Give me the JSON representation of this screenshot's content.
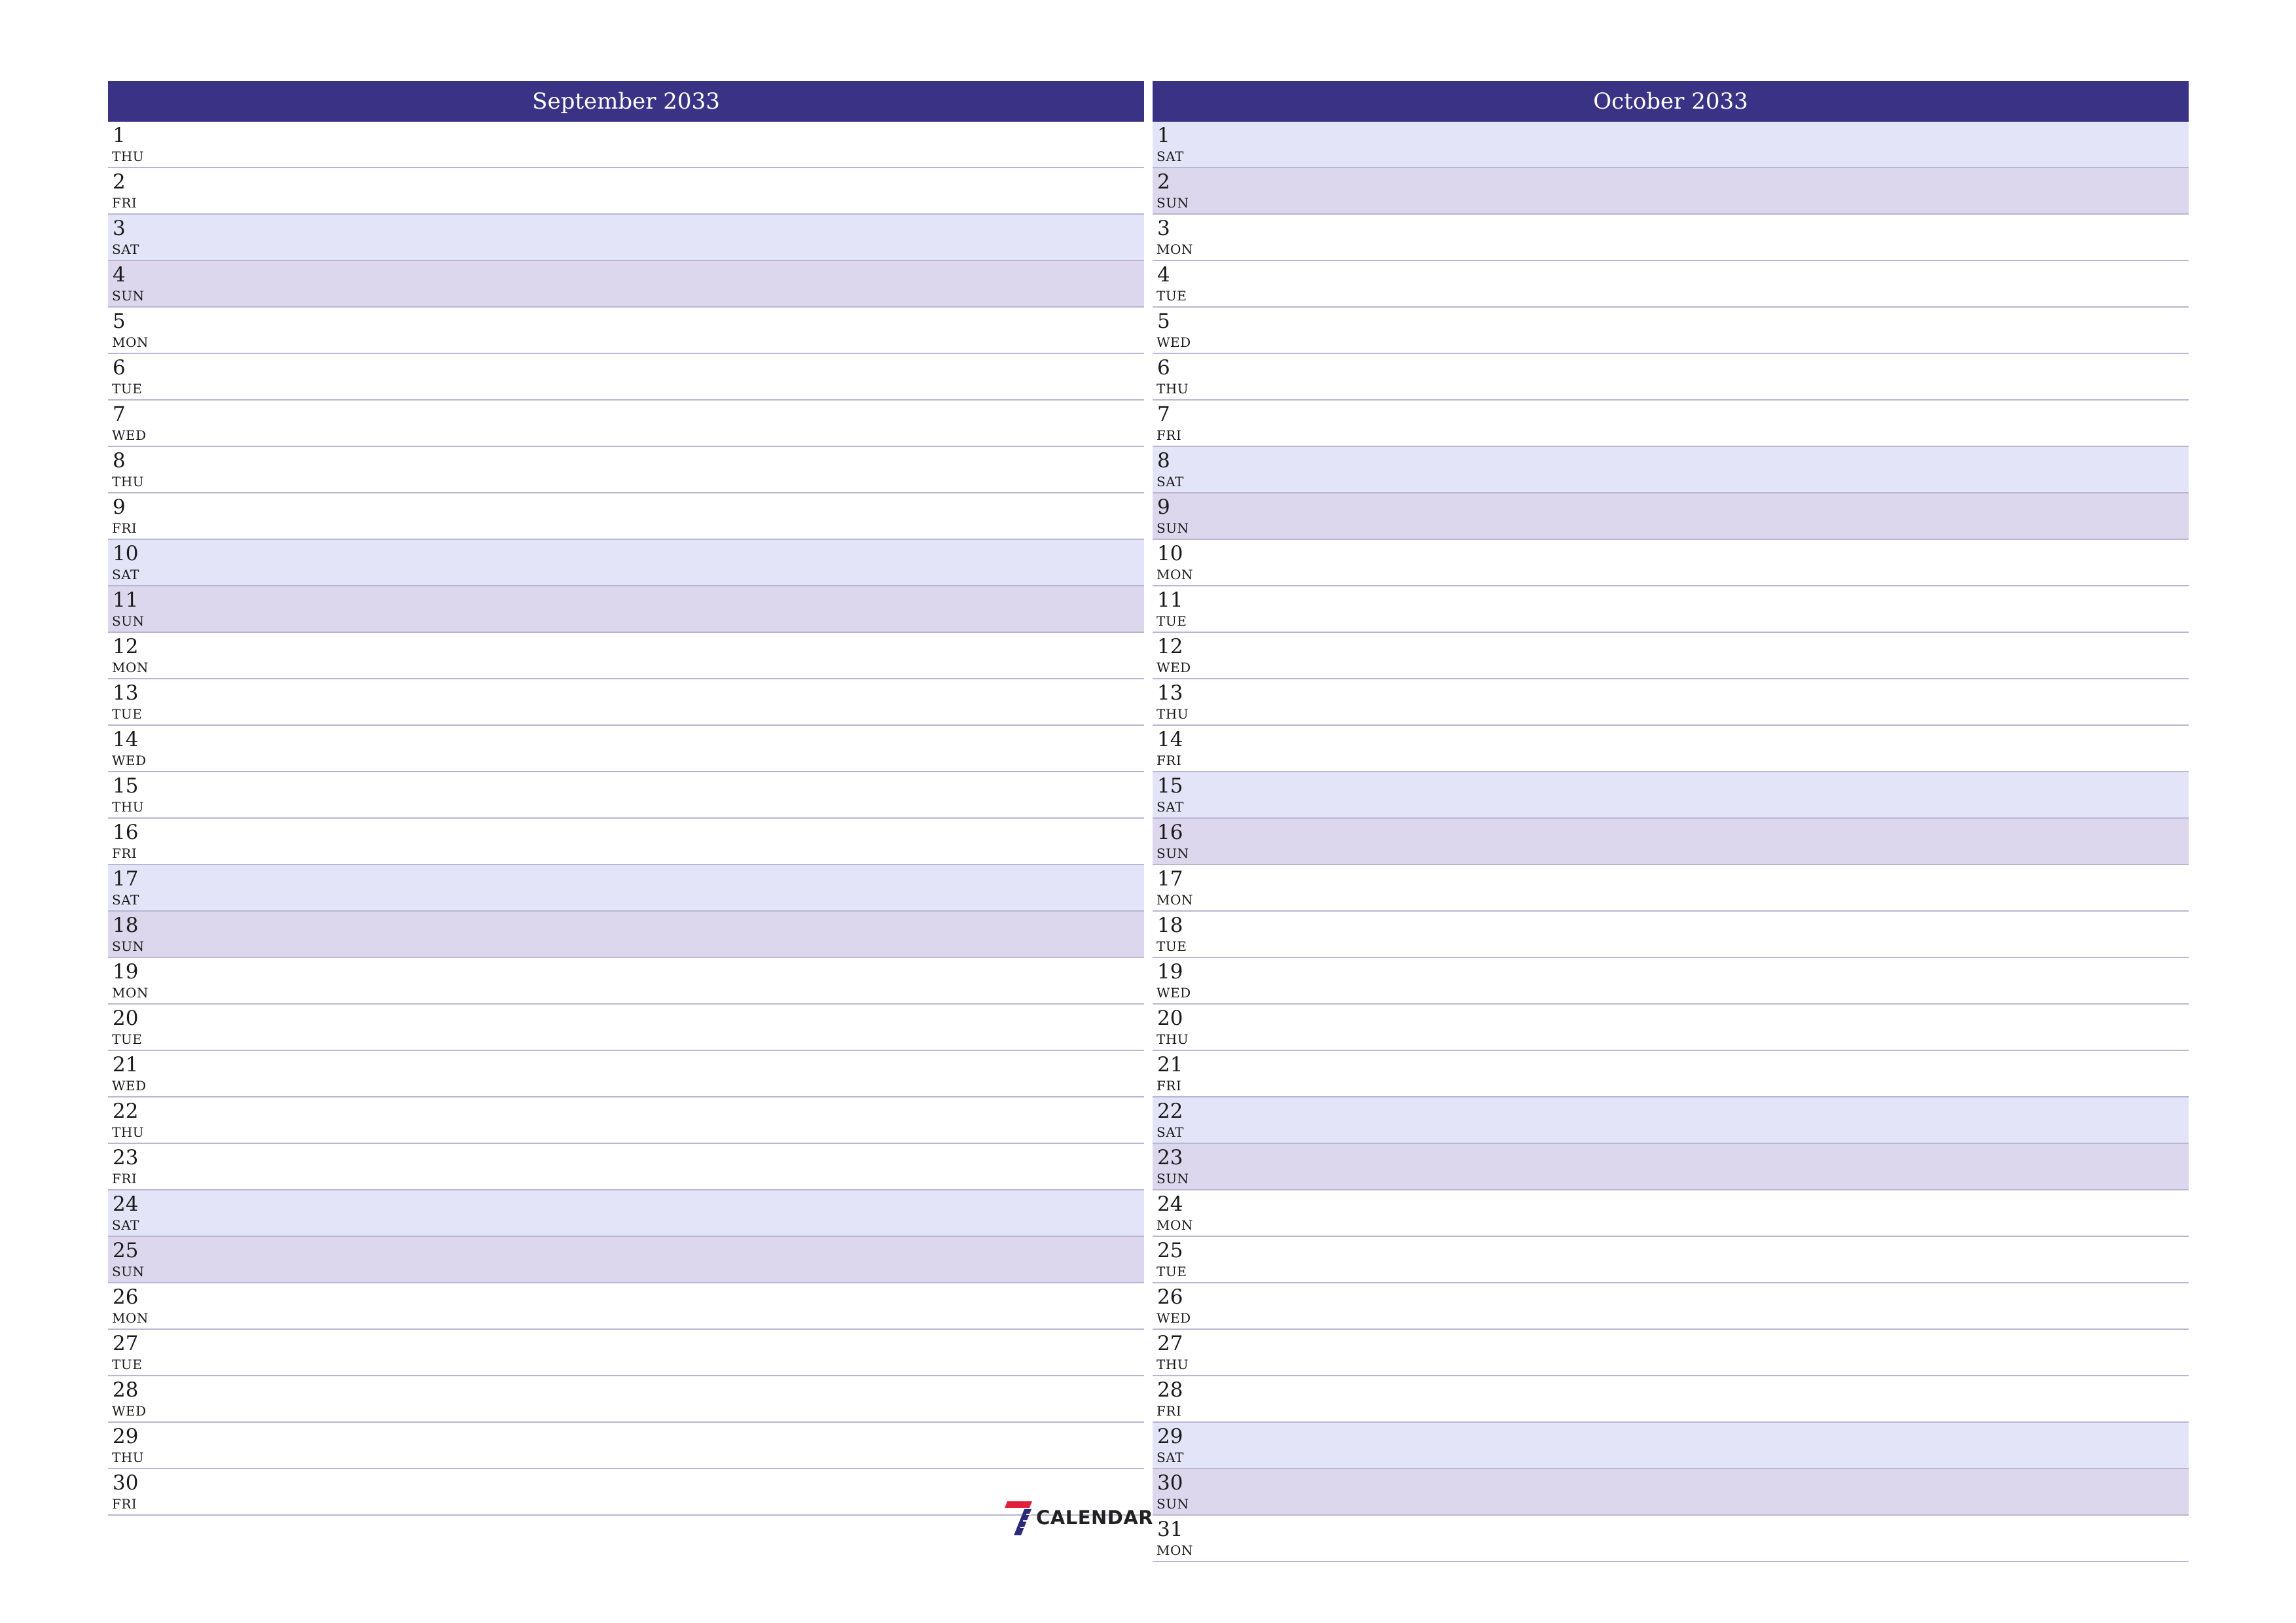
{
  "months": [
    {
      "title": "September 2033",
      "days": [
        {
          "num": "1",
          "dow": "THU"
        },
        {
          "num": "2",
          "dow": "FRI"
        },
        {
          "num": "3",
          "dow": "SAT"
        },
        {
          "num": "4",
          "dow": "SUN"
        },
        {
          "num": "5",
          "dow": "MON"
        },
        {
          "num": "6",
          "dow": "TUE"
        },
        {
          "num": "7",
          "dow": "WED"
        },
        {
          "num": "8",
          "dow": "THU"
        },
        {
          "num": "9",
          "dow": "FRI"
        },
        {
          "num": "10",
          "dow": "SAT"
        },
        {
          "num": "11",
          "dow": "SUN"
        },
        {
          "num": "12",
          "dow": "MON"
        },
        {
          "num": "13",
          "dow": "TUE"
        },
        {
          "num": "14",
          "dow": "WED"
        },
        {
          "num": "15",
          "dow": "THU"
        },
        {
          "num": "16",
          "dow": "FRI"
        },
        {
          "num": "17",
          "dow": "SAT"
        },
        {
          "num": "18",
          "dow": "SUN"
        },
        {
          "num": "19",
          "dow": "MON"
        },
        {
          "num": "20",
          "dow": "TUE"
        },
        {
          "num": "21",
          "dow": "WED"
        },
        {
          "num": "22",
          "dow": "THU"
        },
        {
          "num": "23",
          "dow": "FRI"
        },
        {
          "num": "24",
          "dow": "SAT"
        },
        {
          "num": "25",
          "dow": "SUN"
        },
        {
          "num": "26",
          "dow": "MON"
        },
        {
          "num": "27",
          "dow": "TUE"
        },
        {
          "num": "28",
          "dow": "WED"
        },
        {
          "num": "29",
          "dow": "THU"
        },
        {
          "num": "30",
          "dow": "FRI"
        }
      ]
    },
    {
      "title": "October 2033",
      "days": [
        {
          "num": "1",
          "dow": "SAT"
        },
        {
          "num": "2",
          "dow": "SUN"
        },
        {
          "num": "3",
          "dow": "MON"
        },
        {
          "num": "4",
          "dow": "TUE"
        },
        {
          "num": "5",
          "dow": "WED"
        },
        {
          "num": "6",
          "dow": "THU"
        },
        {
          "num": "7",
          "dow": "FRI"
        },
        {
          "num": "8",
          "dow": "SAT"
        },
        {
          "num": "9",
          "dow": "SUN"
        },
        {
          "num": "10",
          "dow": "MON"
        },
        {
          "num": "11",
          "dow": "TUE"
        },
        {
          "num": "12",
          "dow": "WED"
        },
        {
          "num": "13",
          "dow": "THU"
        },
        {
          "num": "14",
          "dow": "FRI"
        },
        {
          "num": "15",
          "dow": "SAT"
        },
        {
          "num": "16",
          "dow": "SUN"
        },
        {
          "num": "17",
          "dow": "MON"
        },
        {
          "num": "18",
          "dow": "TUE"
        },
        {
          "num": "19",
          "dow": "WED"
        },
        {
          "num": "20",
          "dow": "THU"
        },
        {
          "num": "21",
          "dow": "FRI"
        },
        {
          "num": "22",
          "dow": "SAT"
        },
        {
          "num": "23",
          "dow": "SUN"
        },
        {
          "num": "24",
          "dow": "MON"
        },
        {
          "num": "25",
          "dow": "TUE"
        },
        {
          "num": "26",
          "dow": "WED"
        },
        {
          "num": "27",
          "dow": "THU"
        },
        {
          "num": "28",
          "dow": "FRI"
        },
        {
          "num": "29",
          "dow": "SAT"
        },
        {
          "num": "30",
          "dow": "SUN"
        },
        {
          "num": "31",
          "dow": "MON"
        }
      ]
    }
  ],
  "logo": {
    "mark": "7",
    "text": "CALENDAR"
  },
  "colors": {
    "header_bg": "#3a3284",
    "header_text": "#ffffff",
    "saturday_bg": "#e4e4f8",
    "sunday_bg": "#dcd7ec",
    "row_divider": "#b9b6d3",
    "logo_red": "#e3203b",
    "logo_blue": "#2e2a7a"
  }
}
